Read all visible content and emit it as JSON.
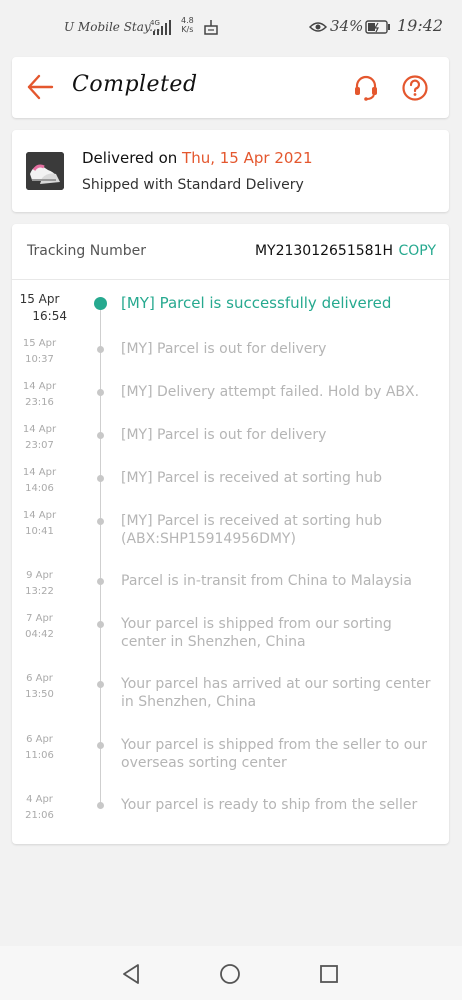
{
  "status_bar": {
    "carrier": "U Mobile Stay...",
    "network": "4G",
    "speed_value": "4.8",
    "speed_unit": "K/s",
    "battery_percent": "34%",
    "time": "19:42"
  },
  "header": {
    "title": "Completed",
    "back_icon": "back-arrow-icon",
    "support_icon": "headset-icon",
    "help_icon": "question-circle-icon"
  },
  "delivery": {
    "title_prefix": "Delivered on",
    "date": "Thu, 15 Apr 2021",
    "subtitle": "Shipped with Standard Delivery"
  },
  "tracking": {
    "label": "Tracking Number",
    "number": "MY213012651581H",
    "copy_label": "COPY",
    "events": [
      {
        "date": "15 Apr",
        "time": "16:54",
        "text": "[MY] Parcel is successfully delivered"
      },
      {
        "date": "15 Apr",
        "time": "10:37",
        "text": "[MY] Parcel is out for delivery"
      },
      {
        "date": "14 Apr",
        "time": "23:16",
        "text": "[MY] Delivery attempt failed. Hold by ABX."
      },
      {
        "date": "14 Apr",
        "time": "23:07",
        "text": "[MY] Parcel is out for delivery"
      },
      {
        "date": "14 Apr",
        "time": "14:06",
        "text": "[MY] Parcel is received at sorting hub"
      },
      {
        "date": "14 Apr",
        "time": "10:41",
        "text": "[MY] Parcel is received at sorting hub (ABX:SHP15914956DMY)"
      },
      {
        "date": "9 Apr",
        "time": "13:22",
        "text": "Parcel is in-transit from China to Malaysia"
      },
      {
        "date": "7 Apr",
        "time": "04:42",
        "text": "Your parcel is shipped from our sorting center in Shenzhen, China"
      },
      {
        "date": "6 Apr",
        "time": "13:50",
        "text": "Your parcel has arrived at our sorting center in Shenzhen, China"
      },
      {
        "date": "6 Apr",
        "time": "11:06",
        "text": "Your parcel is shipped from the seller to our overseas sorting center"
      },
      {
        "date": "4 Apr",
        "time": "21:06",
        "text": "Your parcel is ready to ship from the seller"
      }
    ]
  },
  "nav": {
    "back_icon": "triangle-back-icon",
    "home_icon": "circle-home-icon",
    "recent_icon": "square-recent-icon"
  },
  "colors": {
    "accent": "#e4572e",
    "success": "#26a98f",
    "muted_text": "#b5b5b5"
  }
}
